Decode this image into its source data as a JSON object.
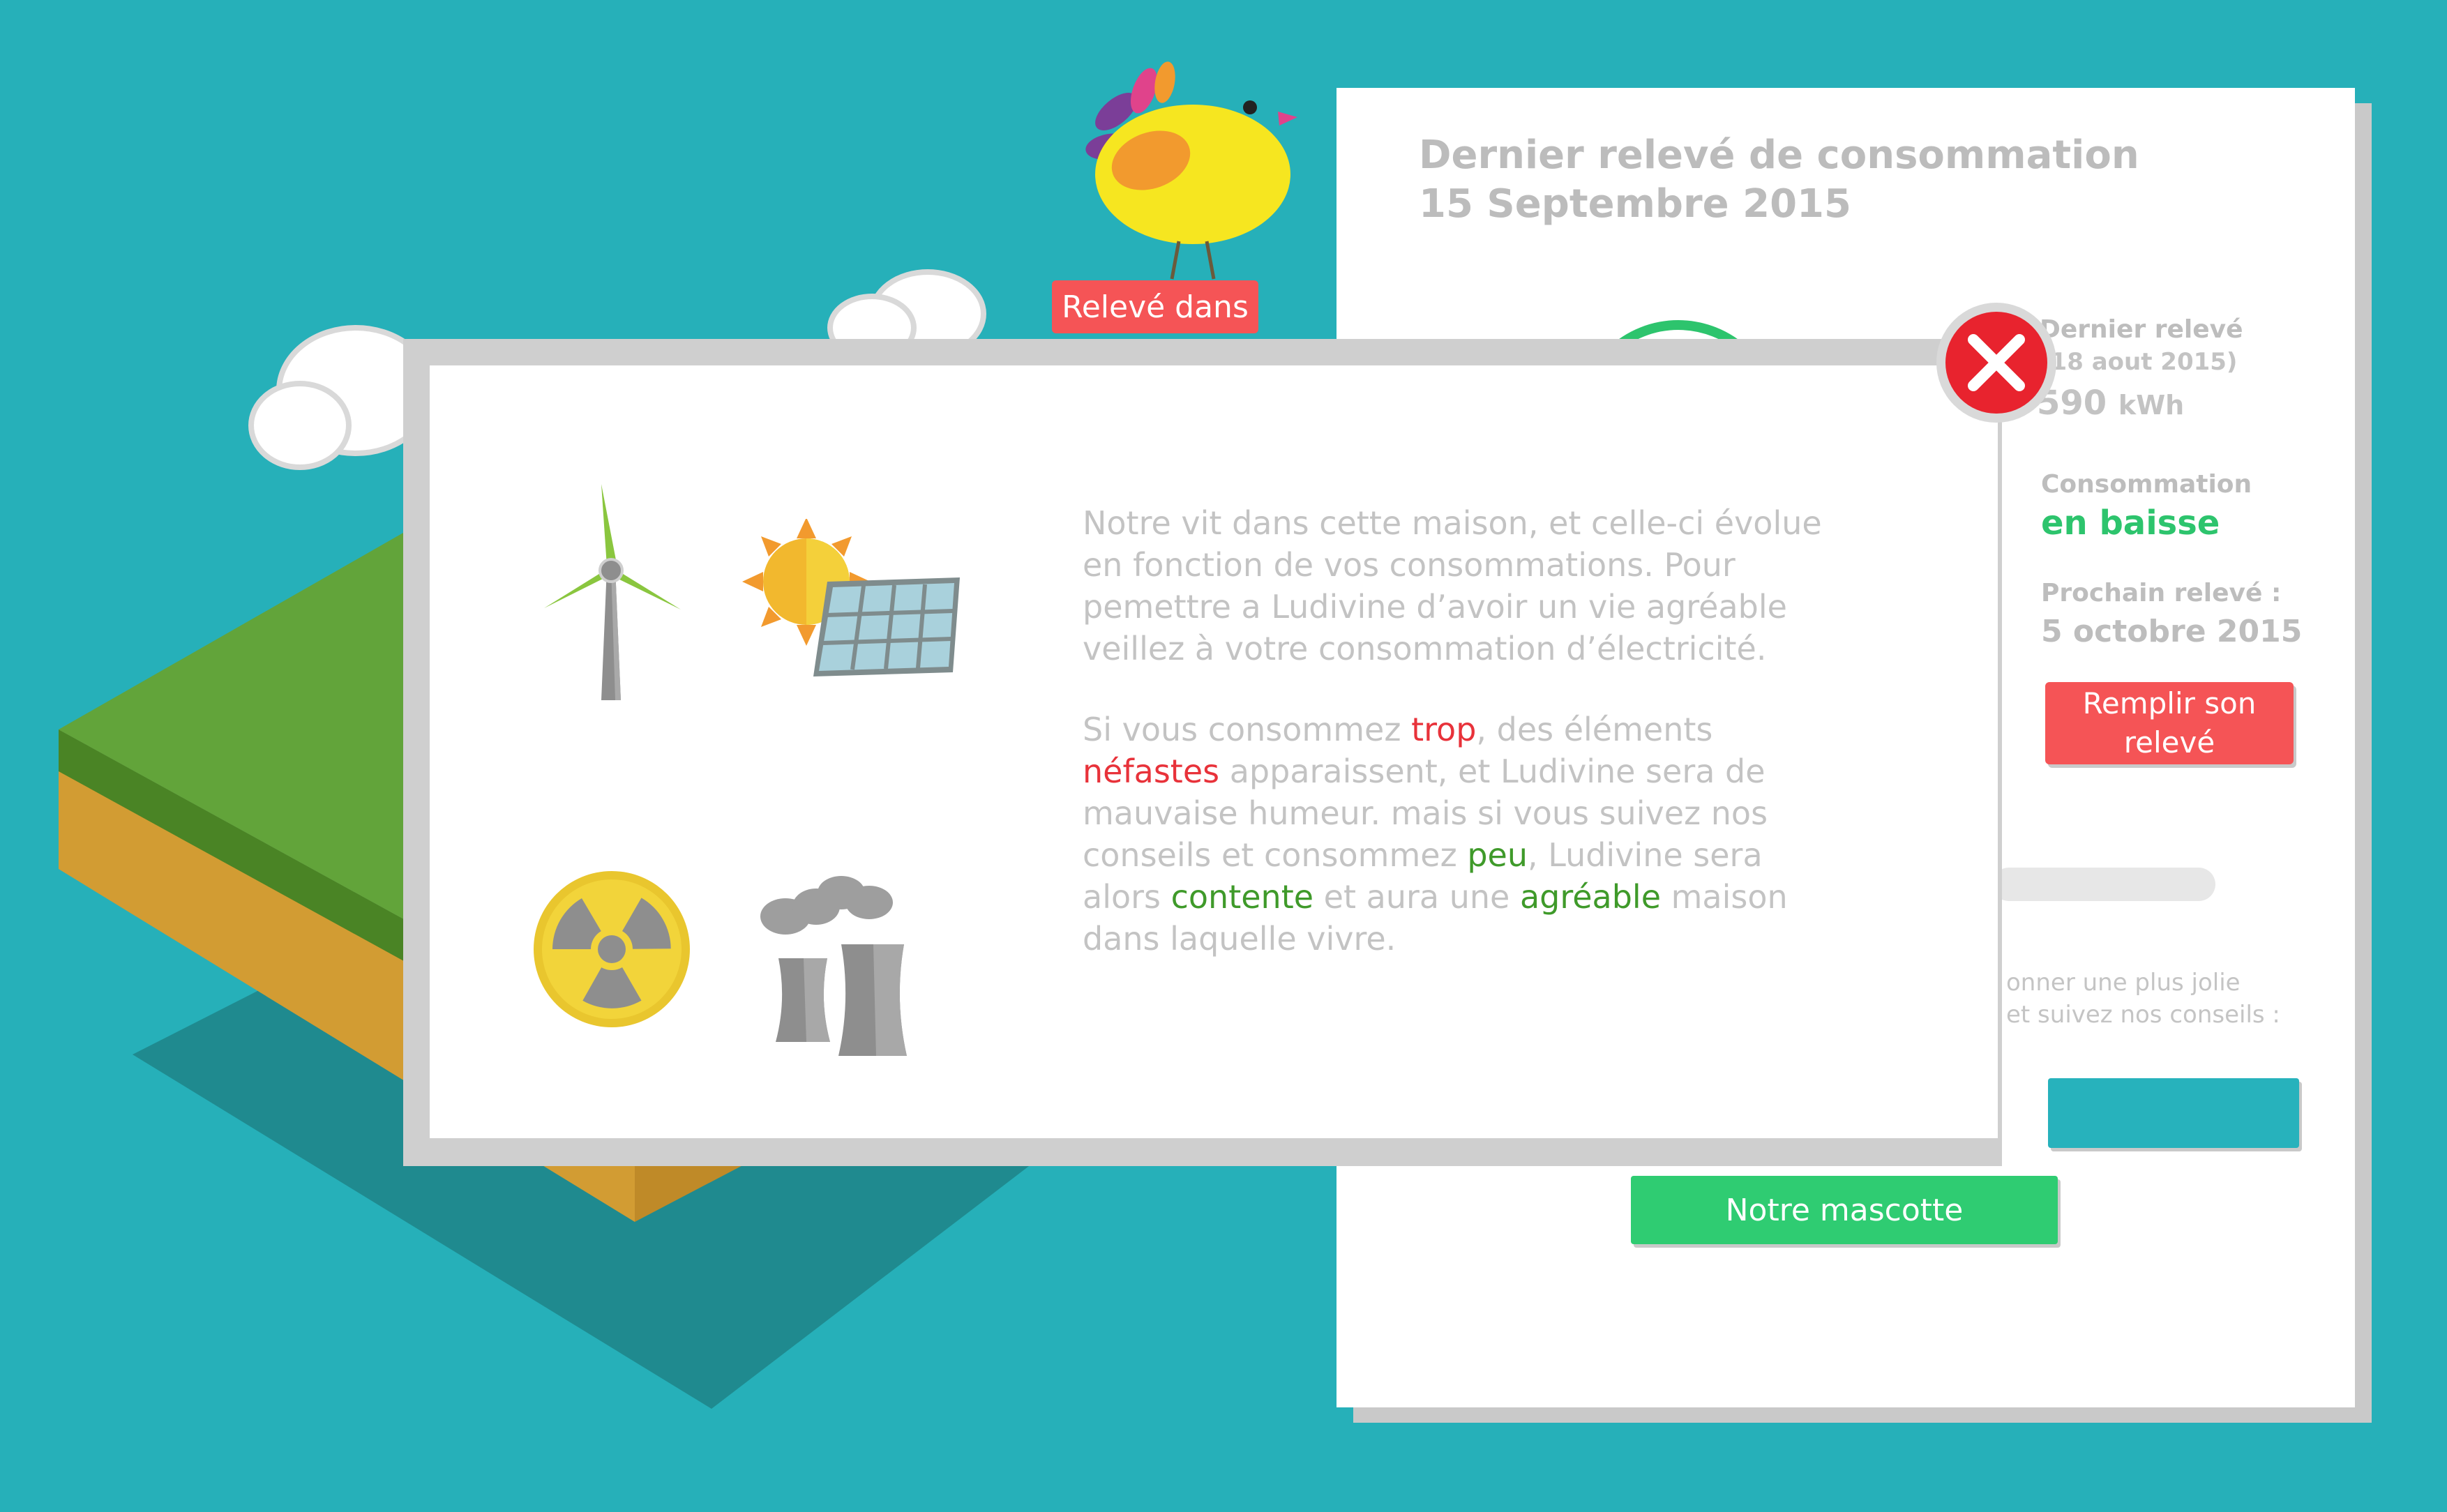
{
  "panel": {
    "title_line1": "Dernier relevé de consommation",
    "title_line2": "15 Septembre 2015",
    "last_reading": {
      "label": "Dernier relevé",
      "date": "(18 aout 2015)",
      "value": "590",
      "unit": "kWh"
    },
    "trend": {
      "label": "Consommation",
      "value": "en baisse"
    },
    "next_reading": {
      "label": "Prochain relevé :",
      "date": "5 octobre 2015"
    },
    "fill_button_label": "Remplir son relevé",
    "advice_line1": "onner une plus jolie",
    "advice_line2": "et suivez nos conseils :",
    "mascot_button_label": "Notre mascotte"
  },
  "bird_tag": {
    "label": "Relevé dans"
  },
  "modal": {
    "paragraph1": "Notre vit dans cette maison, et celle-ci évolue en fonction de vos consommations. Pour pemettre a Ludivine d’avoir un vie agréable veillez à votre consommation d’électricité.",
    "p2_a": "Si vous consommez ",
    "p2_trop": "trop",
    "p2_b": ", des éléments ",
    "p2_nefastes": "néfastes",
    "p2_c": " apparaissent, et Ludivine sera de mauvaise humeur. mais si vous suivez nos conseils et consommez ",
    "p2_peu": "peu",
    "p2_d": ", Ludivine sera alors ",
    "p2_contente": "contente",
    "p2_e": " et aura une ",
    "p2_agreable": "agréable",
    "p2_f": " maison dans laquelle vivre.",
    "icons": [
      "wind-turbine-icon",
      "sun-solar-panel-icon",
      "radioactive-icon",
      "nuclear-plant-icon"
    ]
  },
  "colors": {
    "background": "#26b0b9",
    "accent_red": "#f55456",
    "accent_green": "#2fcc72",
    "text_grey": "#c3c3c3"
  }
}
